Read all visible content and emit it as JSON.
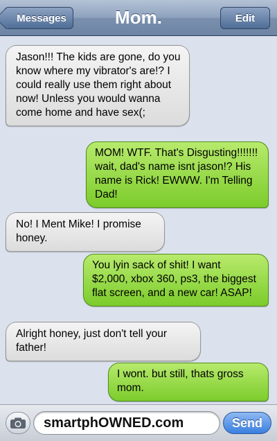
{
  "header": {
    "title": "Mom.",
    "back_label": "Messages",
    "edit_label": "Edit"
  },
  "messages": [
    {
      "direction": "incoming",
      "text": "Jason!!! The kids are gone, do you know where my vibrator's are!? I could really use them right about now! Unless you would wanna come home and have sex(;"
    },
    {
      "direction": "outgoing",
      "text": "MOM! WTF. That's Disgusting!!!!!!! wait, dad's name isnt jason!? His name is Rick! EWWW. I'm Telling Dad!"
    },
    {
      "direction": "incoming",
      "text": "No! I Ment Mike! I promise honey."
    },
    {
      "direction": "outgoing",
      "text": "You lyin sack of shit! I want $2,000, xbox 360, ps3, the biggest flat screen, and a new car! ASAP!"
    },
    {
      "direction": "incoming",
      "text": "Alright honey, just don't tell your father!"
    },
    {
      "direction": "outgoing",
      "text": "I wont. but still, thats gross mom."
    }
  ],
  "composer": {
    "field_text": "smartphOWNED.com",
    "send_label": "Send",
    "camera_icon": "camera-icon"
  },
  "colors": {
    "incoming_bubble": "#e6e6e6",
    "outgoing_bubble": "#8fd63f",
    "navbar": "#7a90ae",
    "send_button": "#3a7fe0"
  }
}
